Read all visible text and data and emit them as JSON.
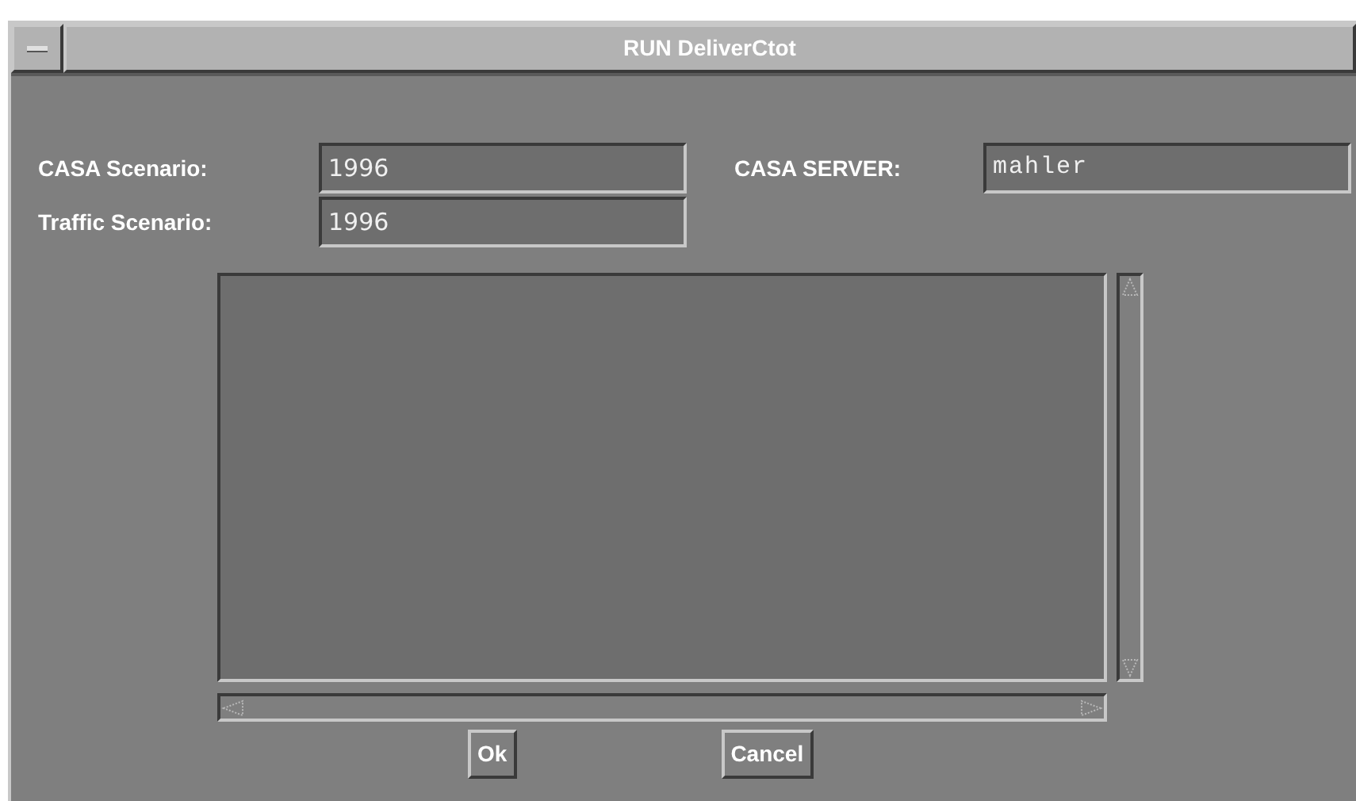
{
  "window": {
    "title": "RUN DeliverCtot"
  },
  "fields": [
    {
      "label": "CASA Scenario:",
      "value": "1996",
      "mono": false
    },
    {
      "label": "Traffic Scenario:",
      "value": "1996",
      "mono": false
    }
  ],
  "server": {
    "label": "CASA SERVER:",
    "value": "mahler",
    "mono": true
  },
  "buttons": [
    "Ok",
    "Cancel"
  ]
}
